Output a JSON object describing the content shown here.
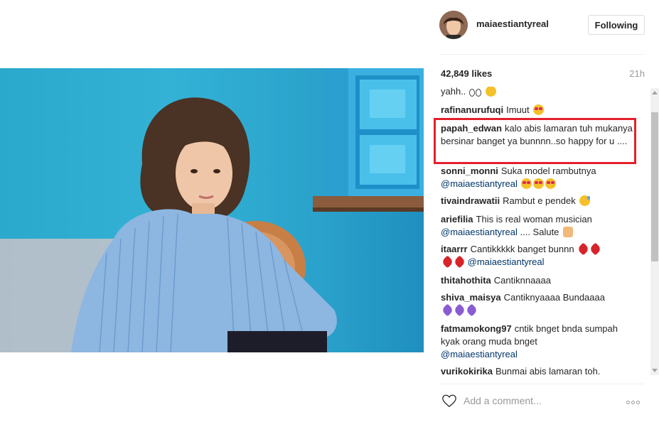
{
  "post": {
    "username": "maiaestiantyreal",
    "follow_label": "Following",
    "likes": "42,849 likes",
    "time": "21h"
  },
  "comments": [
    {
      "user": "",
      "text": "yahh..",
      "emoji": [
        "eyes",
        "eyes",
        "grin"
      ]
    },
    {
      "user": "rafinanurufuqi",
      "text": "Imuut",
      "emoji": [
        "heart-eyes"
      ]
    },
    {
      "user": "papah_edwan",
      "text": "kalo abis lamaran tuh mukanya bersinar banget ya bunnnn..so happy for u ....",
      "emoji": []
    },
    {
      "user": "sonni_monni",
      "text": "Suka model rambutnya",
      "mention": "@maiaestiantyreal",
      "emoji": [
        "heart-eyes",
        "heart-eyes",
        "heart-eyes"
      ]
    },
    {
      "user": "tivaindrawatii",
      "text": "Rambut e pendek",
      "emoji": [
        "sweat"
      ]
    },
    {
      "user": "ariefilia",
      "text": "This is real woman musician",
      "mention": "@maiaestiantyreal",
      "text_after": ".... Salute",
      "emoji": [
        "pray"
      ]
    },
    {
      "user": "itaarrr",
      "text": "Cantikkkkk banget bunnn",
      "mention": "@maiaestiantyreal",
      "emoji": [
        "broken-heart",
        "broken-heart",
        "broken-heart",
        "broken-heart"
      ]
    },
    {
      "user": "thitahothita",
      "text": "Cantiknnaaaa",
      "emoji": []
    },
    {
      "user": "shiva_maisya",
      "text": "Cantiknyaaaa Bundaaaa",
      "emoji": [
        "purple-heart",
        "purple-heart",
        "purple-heart"
      ]
    },
    {
      "user": "fatmamokong97",
      "text": "cntik bnget bnda sumpah kyak orang muda bnget",
      "mention": "@maiaestiantyreal",
      "emoji": []
    },
    {
      "user": "vurikokirika",
      "text": "Bunmai abis lamaran toh.",
      "emoji": []
    }
  ],
  "add_comment": {
    "placeholder": "Add a comment..."
  },
  "icons": {
    "like": "heart-outline-icon",
    "more": "more-options-icon"
  },
  "colors": {
    "highlight": "#e3202a",
    "mention": "#003569",
    "background_photo": "#2ba9cc"
  }
}
